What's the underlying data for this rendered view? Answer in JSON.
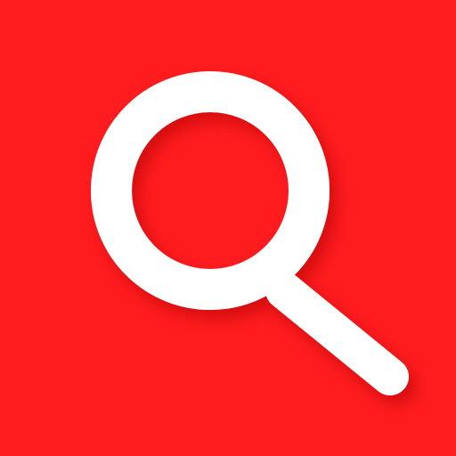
{
  "icon": {
    "name": "search-icon",
    "background_color": "#ff1c1f",
    "glyph_color": "#ffffff",
    "shadow_color": "#7a0000"
  }
}
